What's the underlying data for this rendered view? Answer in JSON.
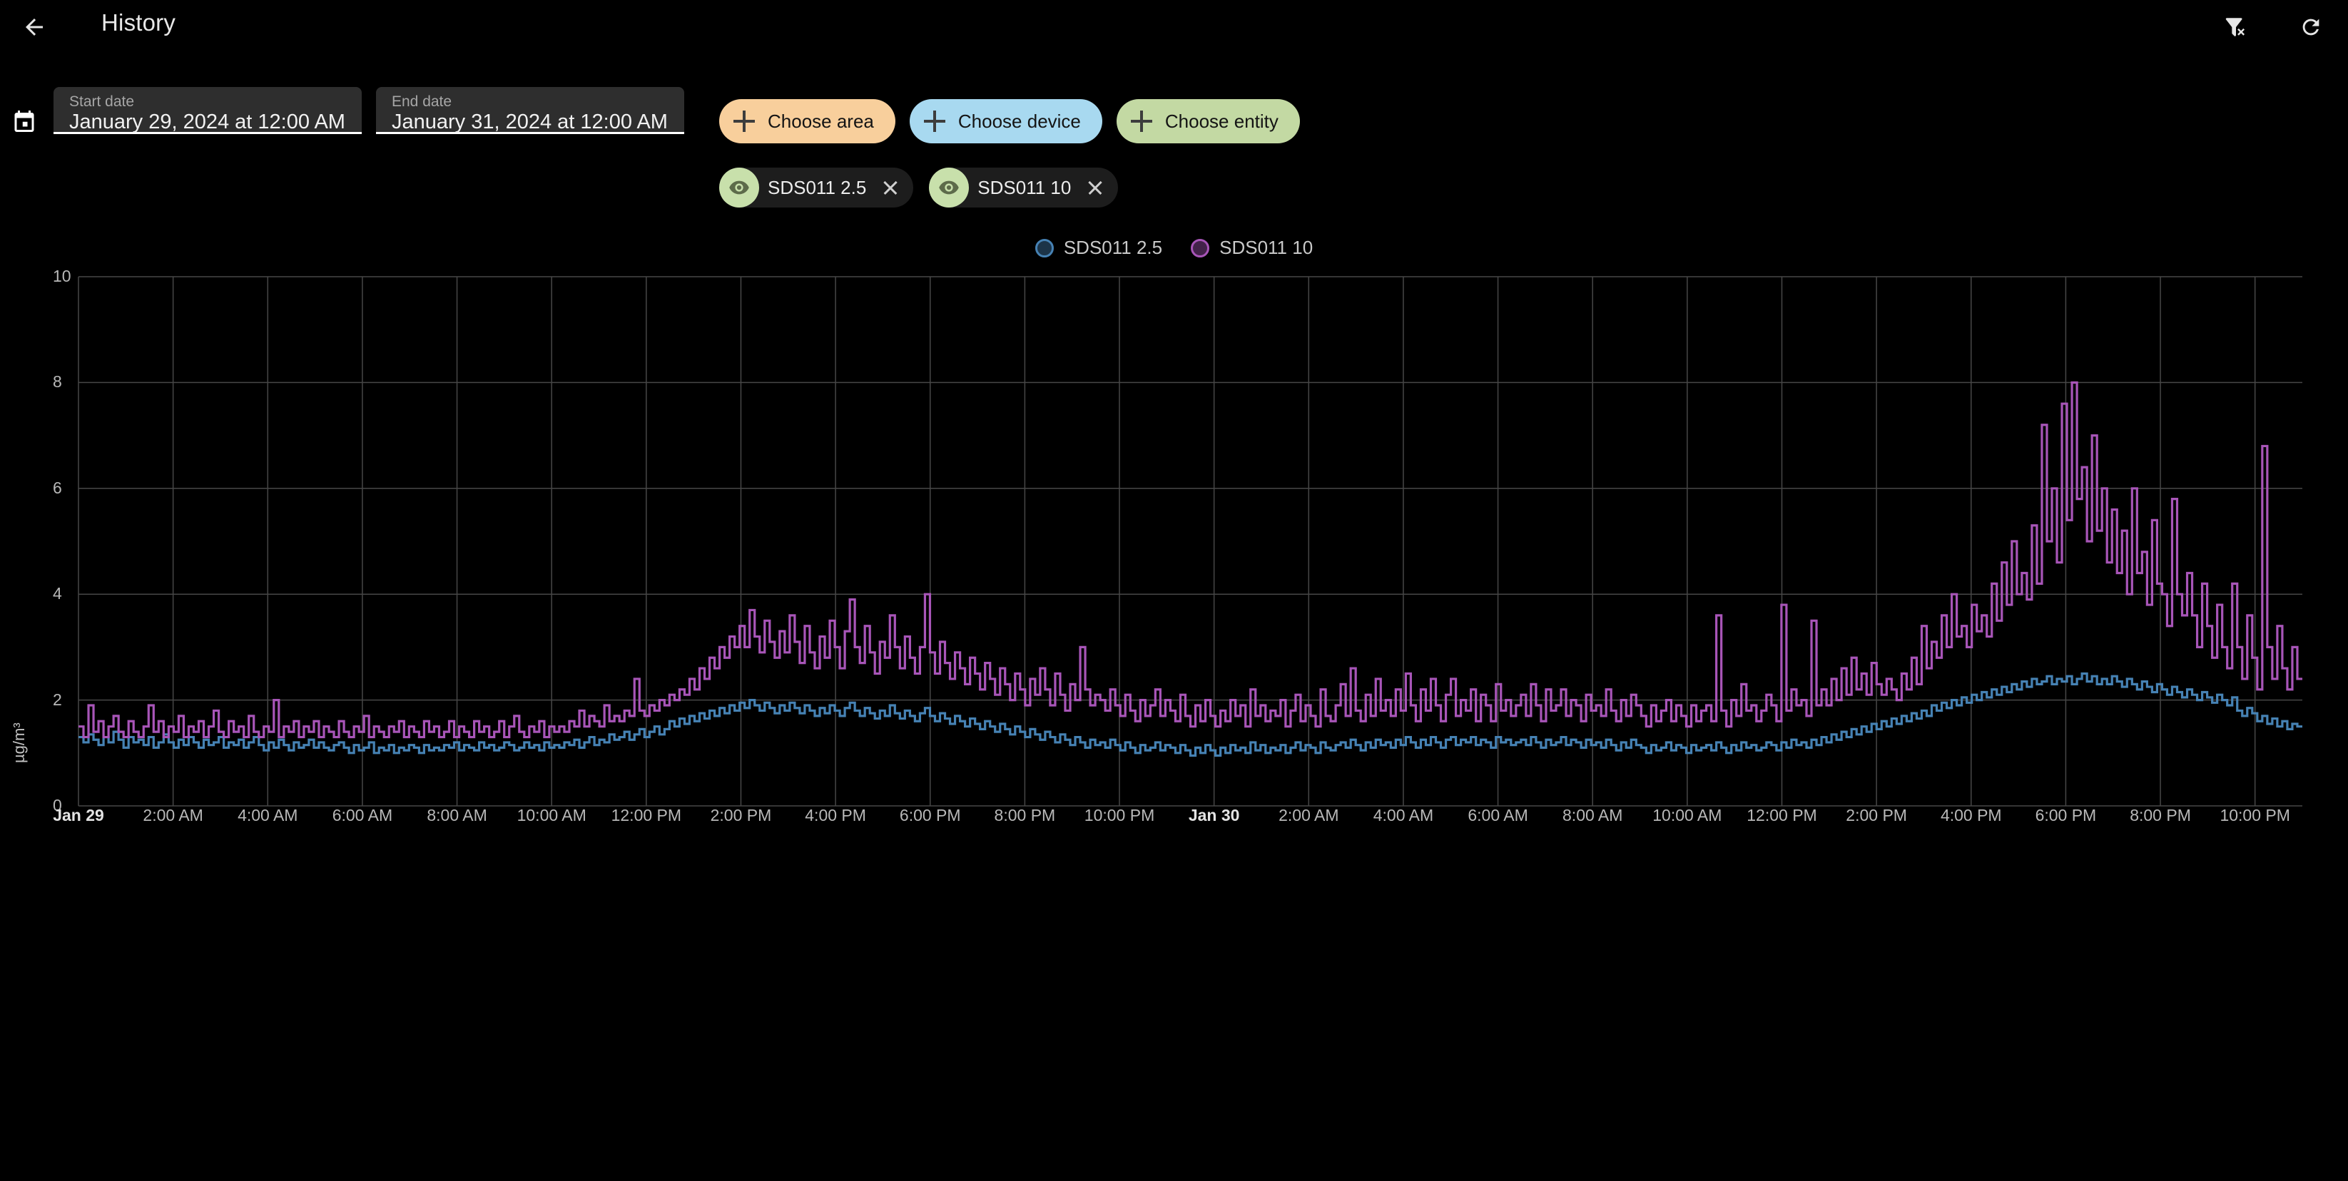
{
  "app_bar": {
    "title": "History",
    "back_icon": "arrow-left-icon",
    "filter_remove_icon": "filter-remove-icon",
    "refresh_icon": "refresh-icon"
  },
  "date_range": {
    "calendar_icon": "calendar-icon",
    "start": {
      "label": "Start date",
      "value": "January 29, 2024 at 12:00 AM"
    },
    "end": {
      "label": "End date",
      "value": "January 31, 2024 at 12:00 AM"
    }
  },
  "choosers": [
    {
      "label": "Choose area",
      "color": "#f8cf9c",
      "icon": "plus-icon"
    },
    {
      "label": "Choose device",
      "color": "#a8d9f0",
      "icon": "plus-icon"
    },
    {
      "label": "Choose entity",
      "color": "#c3d9a3",
      "icon": "plus-icon"
    }
  ],
  "entity_chips": [
    {
      "label": "SDS011 2.5",
      "badge_color": "#c8e0ab",
      "icon": "eye-icon",
      "close_icon": "close-icon"
    },
    {
      "label": "SDS011 10",
      "badge_color": "#c8e0ab",
      "icon": "eye-icon",
      "close_icon": "close-icon"
    }
  ],
  "colors": {
    "background": "#000000",
    "grid": "#474747",
    "axis_text": "#b8b8b8",
    "series_pm25": "#4682b4",
    "series_pm10": "#a855b8"
  },
  "chart_data": {
    "type": "line",
    "title": "",
    "subtitle": "",
    "xlabel": "",
    "ylabel": "µg/m³",
    "ylim": [
      0,
      10
    ],
    "yticks": [
      0,
      2,
      4,
      6,
      8,
      10
    ],
    "grid": true,
    "legend_position": "top-center",
    "x_range": [
      "Jan 29 12:00 AM",
      "Jan 30 10:55 PM"
    ],
    "x_tick_labels": [
      "Jan 29",
      "2:00 AM",
      "4:00 AM",
      "6:00 AM",
      "8:00 AM",
      "10:00 AM",
      "12:00 PM",
      "2:00 PM",
      "4:00 PM",
      "6:00 PM",
      "8:00 PM",
      "10:00 PM",
      "Jan 30",
      "2:00 AM",
      "4:00 AM",
      "6:00 AM",
      "8:00 AM",
      "10:00 AM",
      "12:00 PM",
      "2:00 PM",
      "4:00 PM",
      "6:00 PM",
      "8:00 PM",
      "10:00 PM"
    ],
    "x_tick_bold": [
      0,
      12
    ],
    "x_tick_hours": [
      0,
      2,
      4,
      6,
      8,
      10,
      12,
      14,
      16,
      18,
      20,
      22,
      24,
      26,
      28,
      30,
      32,
      34,
      36,
      38,
      40,
      42,
      44,
      46
    ],
    "series": [
      {
        "name": "SDS011 2.5",
        "color": "#4682b4",
        "unit": "µg/m³",
        "sample_interval_minutes": 10,
        "values": [
          1.3,
          1.2,
          1.35,
          1.25,
          1.15,
          1.3,
          1.2,
          1.4,
          1.25,
          1.1,
          1.3,
          1.2,
          1.25,
          1.15,
          1.3,
          1.1,
          1.2,
          1.35,
          1.2,
          1.1,
          1.25,
          1.15,
          1.3,
          1.2,
          1.1,
          1.25,
          1.15,
          1.2,
          1.3,
          1.1,
          1.2,
          1.15,
          1.25,
          1.1,
          1.2,
          1.3,
          1.15,
          1.05,
          1.2,
          1.1,
          1.25,
          1.15,
          1.05,
          1.2,
          1.1,
          1.15,
          1.25,
          1.1,
          1.2,
          1.1,
          1.05,
          1.15,
          1.2,
          1.1,
          1.0,
          1.15,
          1.05,
          1.1,
          1.2,
          1.0,
          1.1,
          1.05,
          1.15,
          1.0,
          1.1,
          1.05,
          1.15,
          1.1,
          1.0,
          1.15,
          1.05,
          1.1,
          1.05,
          1.15,
          1.1,
          1.2,
          1.05,
          1.15,
          1.1,
          1.05,
          1.2,
          1.1,
          1.15,
          1.05,
          1.1,
          1.2,
          1.15,
          1.05,
          1.1,
          1.2,
          1.1,
          1.15,
          1.05,
          1.2,
          1.1,
          1.15,
          1.1,
          1.2,
          1.15,
          1.25,
          1.1,
          1.2,
          1.3,
          1.15,
          1.25,
          1.2,
          1.35,
          1.25,
          1.3,
          1.4,
          1.25,
          1.35,
          1.45,
          1.3,
          1.4,
          1.5,
          1.35,
          1.45,
          1.6,
          1.5,
          1.65,
          1.55,
          1.7,
          1.6,
          1.75,
          1.65,
          1.8,
          1.7,
          1.85,
          1.75,
          1.9,
          1.8,
          1.95,
          1.85,
          2.0,
          1.9,
          1.8,
          1.95,
          1.85,
          1.75,
          1.9,
          1.8,
          1.95,
          1.85,
          1.75,
          1.9,
          1.8,
          1.7,
          1.85,
          1.75,
          1.9,
          1.8,
          1.7,
          1.85,
          1.95,
          1.8,
          1.7,
          1.85,
          1.75,
          1.65,
          1.8,
          1.7,
          1.9,
          1.75,
          1.65,
          1.8,
          1.7,
          1.6,
          1.75,
          1.85,
          1.7,
          1.6,
          1.75,
          1.65,
          1.55,
          1.7,
          1.6,
          1.5,
          1.65,
          1.55,
          1.45,
          1.6,
          1.5,
          1.4,
          1.55,
          1.45,
          1.35,
          1.5,
          1.4,
          1.3,
          1.45,
          1.35,
          1.25,
          1.4,
          1.3,
          1.2,
          1.35,
          1.25,
          1.15,
          1.3,
          1.2,
          1.1,
          1.25,
          1.15,
          1.2,
          1.1,
          1.25,
          1.15,
          1.05,
          1.2,
          1.1,
          1.0,
          1.15,
          1.05,
          1.1,
          1.2,
          1.05,
          1.15,
          1.1,
          1.0,
          1.15,
          1.05,
          0.95,
          1.1,
          1.0,
          1.15,
          1.05,
          0.95,
          1.1,
          1.0,
          1.15,
          1.05,
          1.1,
          1.0,
          1.2,
          1.05,
          1.15,
          1.0,
          1.1,
          1.05,
          1.15,
          1.0,
          1.1,
          1.2,
          1.05,
          1.15,
          1.1,
          1.0,
          1.2,
          1.1,
          1.05,
          1.15,
          1.2,
          1.1,
          1.25,
          1.15,
          1.05,
          1.2,
          1.1,
          1.25,
          1.15,
          1.2,
          1.1,
          1.25,
          1.15,
          1.3,
          1.2,
          1.1,
          1.25,
          1.15,
          1.3,
          1.2,
          1.1,
          1.25,
          1.3,
          1.15,
          1.25,
          1.2,
          1.3,
          1.15,
          1.25,
          1.2,
          1.1,
          1.3,
          1.2,
          1.25,
          1.15,
          1.2,
          1.25,
          1.15,
          1.3,
          1.2,
          1.1,
          1.25,
          1.15,
          1.2,
          1.3,
          1.15,
          1.25,
          1.2,
          1.1,
          1.25,
          1.15,
          1.2,
          1.1,
          1.25,
          1.15,
          1.05,
          1.2,
          1.1,
          1.25,
          1.15,
          1.1,
          1.0,
          1.15,
          1.05,
          1.1,
          1.2,
          1.05,
          1.15,
          1.1,
          1.0,
          1.15,
          1.05,
          1.1,
          1.15,
          1.05,
          1.2,
          1.1,
          1.0,
          1.15,
          1.05,
          1.2,
          1.1,
          1.15,
          1.05,
          1.1,
          1.2,
          1.15,
          1.05,
          1.2,
          1.1,
          1.25,
          1.15,
          1.2,
          1.1,
          1.25,
          1.15,
          1.3,
          1.2,
          1.35,
          1.25,
          1.4,
          1.3,
          1.45,
          1.35,
          1.5,
          1.4,
          1.55,
          1.45,
          1.6,
          1.5,
          1.65,
          1.55,
          1.7,
          1.6,
          1.75,
          1.65,
          1.8,
          1.7,
          1.9,
          1.8,
          1.95,
          1.85,
          2.0,
          1.9,
          2.05,
          1.95,
          2.1,
          2.0,
          2.15,
          2.05,
          2.2,
          2.1,
          2.25,
          2.15,
          2.3,
          2.2,
          2.35,
          2.25,
          2.4,
          2.3,
          2.35,
          2.45,
          2.3,
          2.4,
          2.35,
          2.45,
          2.3,
          2.4,
          2.5,
          2.35,
          2.45,
          2.3,
          2.4,
          2.3,
          2.45,
          2.35,
          2.25,
          2.4,
          2.3,
          2.2,
          2.35,
          2.25,
          2.15,
          2.3,
          2.2,
          2.1,
          2.25,
          2.15,
          2.05,
          2.2,
          2.1,
          2.0,
          2.15,
          2.05,
          1.95,
          2.1,
          2.0,
          1.9,
          2.05,
          1.8,
          1.7,
          1.85,
          1.75,
          1.6,
          1.7,
          1.55,
          1.65,
          1.5,
          1.6,
          1.45,
          1.55,
          1.5
        ]
      },
      {
        "name": "SDS011 10",
        "color": "#a855b8",
        "unit": "µg/m³",
        "sample_interval_minutes": 10,
        "values": [
          1.5,
          1.3,
          1.9,
          1.4,
          1.6,
          1.3,
          1.5,
          1.7,
          1.4,
          1.3,
          1.6,
          1.4,
          1.3,
          1.5,
          1.9,
          1.4,
          1.6,
          1.3,
          1.5,
          1.4,
          1.7,
          1.3,
          1.5,
          1.4,
          1.6,
          1.3,
          1.5,
          1.8,
          1.4,
          1.3,
          1.6,
          1.4,
          1.5,
          1.3,
          1.7,
          1.4,
          1.3,
          1.5,
          1.4,
          2.0,
          1.3,
          1.5,
          1.4,
          1.6,
          1.3,
          1.5,
          1.4,
          1.6,
          1.3,
          1.5,
          1.4,
          1.3,
          1.6,
          1.4,
          1.3,
          1.5,
          1.4,
          1.7,
          1.3,
          1.5,
          1.4,
          1.3,
          1.5,
          1.4,
          1.6,
          1.3,
          1.5,
          1.4,
          1.3,
          1.6,
          1.4,
          1.5,
          1.3,
          1.4,
          1.6,
          1.3,
          1.5,
          1.4,
          1.3,
          1.6,
          1.4,
          1.5,
          1.3,
          1.4,
          1.6,
          1.3,
          1.5,
          1.7,
          1.4,
          1.3,
          1.5,
          1.4,
          1.6,
          1.3,
          1.5,
          1.4,
          1.5,
          1.4,
          1.6,
          1.5,
          1.8,
          1.5,
          1.7,
          1.6,
          1.5,
          1.9,
          1.6,
          1.7,
          1.6,
          1.8,
          1.7,
          2.4,
          1.8,
          1.7,
          1.9,
          1.8,
          2.0,
          1.9,
          2.1,
          2.0,
          2.2,
          2.1,
          2.4,
          2.2,
          2.6,
          2.4,
          2.8,
          2.6,
          3.0,
          2.8,
          3.2,
          3.0,
          3.4,
          3.0,
          3.7,
          3.2,
          2.9,
          3.5,
          3.1,
          2.8,
          3.3,
          2.9,
          3.6,
          3.1,
          2.7,
          3.4,
          2.9,
          2.6,
          3.2,
          2.8,
          3.5,
          3.0,
          2.6,
          3.3,
          3.9,
          3.0,
          2.7,
          3.4,
          2.9,
          2.5,
          3.1,
          2.8,
          3.6,
          3.0,
          2.6,
          3.2,
          2.8,
          2.5,
          3.0,
          4.0,
          2.9,
          2.5,
          3.1,
          2.7,
          2.4,
          2.9,
          2.6,
          2.3,
          2.8,
          2.5,
          2.2,
          2.7,
          2.4,
          2.1,
          2.6,
          2.3,
          2.0,
          2.5,
          2.2,
          1.9,
          2.4,
          2.1,
          2.6,
          2.2,
          1.9,
          2.5,
          2.1,
          1.8,
          2.3,
          2.0,
          3.0,
          2.2,
          1.9,
          2.1,
          2.0,
          1.8,
          2.2,
          1.9,
          1.7,
          2.1,
          1.8,
          1.6,
          2.0,
          1.7,
          1.9,
          2.2,
          1.7,
          2.0,
          1.8,
          1.6,
          2.1,
          1.7,
          1.5,
          1.9,
          1.6,
          2.0,
          1.7,
          1.5,
          1.8,
          1.6,
          2.0,
          1.7,
          1.9,
          1.5,
          2.2,
          1.7,
          1.9,
          1.6,
          1.8,
          1.7,
          2.0,
          1.5,
          1.8,
          2.1,
          1.6,
          1.9,
          1.7,
          1.5,
          2.2,
          1.7,
          1.6,
          1.9,
          2.3,
          1.7,
          2.6,
          1.8,
          1.6,
          2.1,
          1.7,
          2.4,
          1.8,
          2.0,
          1.7,
          2.2,
          1.8,
          2.5,
          1.9,
          1.6,
          2.2,
          1.8,
          2.4,
          1.9,
          1.6,
          2.1,
          2.4,
          1.7,
          2.0,
          1.8,
          2.2,
          1.6,
          2.1,
          1.9,
          1.6,
          2.3,
          1.8,
          2.0,
          1.7,
          1.9,
          2.1,
          1.7,
          2.3,
          1.9,
          1.6,
          2.2,
          1.8,
          1.9,
          2.2,
          1.7,
          2.0,
          1.9,
          1.6,
          2.1,
          1.8,
          1.9,
          1.7,
          2.2,
          1.8,
          1.6,
          2.0,
          1.7,
          2.1,
          1.9,
          1.7,
          1.5,
          1.9,
          1.6,
          1.8,
          2.0,
          1.6,
          1.9,
          1.7,
          1.5,
          1.9,
          1.6,
          1.8,
          1.9,
          1.6,
          3.6,
          1.8,
          1.5,
          2.0,
          1.7,
          2.3,
          1.8,
          1.9,
          1.6,
          1.8,
          2.1,
          1.9,
          1.6,
          3.8,
          1.8,
          2.2,
          1.9,
          2.0,
          1.7,
          3.5,
          1.9,
          2.2,
          1.9,
          2.4,
          2.0,
          2.6,
          2.1,
          2.8,
          2.2,
          2.5,
          2.1,
          2.7,
          2.3,
          2.1,
          2.4,
          2.2,
          2.0,
          2.5,
          2.2,
          2.8,
          2.3,
          3.4,
          2.6,
          3.1,
          2.8,
          3.6,
          3.0,
          4.0,
          3.2,
          3.4,
          3.0,
          3.8,
          3.3,
          3.6,
          3.2,
          4.2,
          3.5,
          4.6,
          3.8,
          5.0,
          4.0,
          4.4,
          3.9,
          5.3,
          4.2,
          7.2,
          5.0,
          6.0,
          4.6,
          7.6,
          5.4,
          8.0,
          5.8,
          6.4,
          5.0,
          7.0,
          5.2,
          6.0,
          4.6,
          5.6,
          4.4,
          5.2,
          4.0,
          6.0,
          4.4,
          4.8,
          3.8,
          5.4,
          4.2,
          4.0,
          3.4,
          5.8,
          4.0,
          3.6,
          4.4,
          3.6,
          3.0,
          4.2,
          3.4,
          2.8,
          3.8,
          3.0,
          2.6,
          4.2,
          3.0,
          2.4,
          3.6,
          2.8,
          2.2,
          6.8,
          3.0,
          2.4,
          3.4,
          2.6,
          2.2,
          3.0,
          2.4
        ]
      }
    ]
  }
}
